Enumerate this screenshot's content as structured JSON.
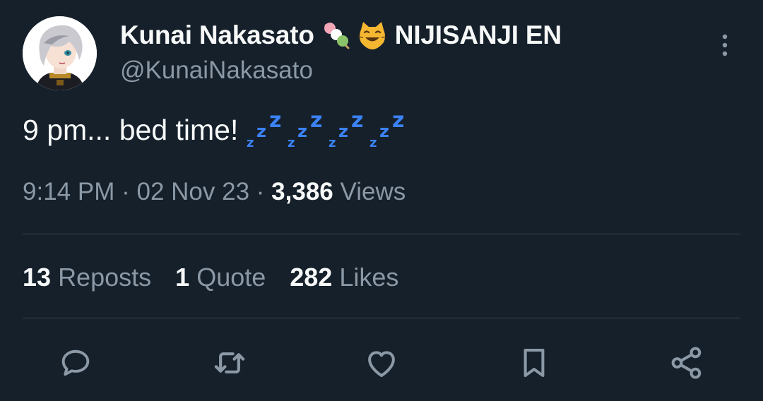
{
  "author": {
    "display_name": "Kunai Nakasato",
    "name_emojis": [
      "dango-emoji",
      "smiling-cat-emoji"
    ],
    "affiliation": "NIJISANJI EN",
    "handle": "@KunaiNakasato"
  },
  "tweet": {
    "text": "9 pm... bed time!",
    "trailing_emoji": [
      "zzz-emoji",
      "zzz-emoji",
      "zzz-emoji",
      "zzz-emoji"
    ]
  },
  "meta": {
    "time": "9:14 PM",
    "separator": "·",
    "date": "02 Nov 23",
    "views_count": "3,386",
    "views_label": "Views"
  },
  "stats": {
    "reposts_count": "13",
    "reposts_label": "Reposts",
    "quotes_count": "1",
    "quotes_label": "Quote",
    "likes_count": "282",
    "likes_label": "Likes"
  },
  "actions": [
    "reply-icon",
    "repost-icon",
    "like-icon",
    "bookmark-icon",
    "share-icon"
  ],
  "colors": {
    "background": "#15202b",
    "primary_text": "#f7f9f9",
    "secondary_text": "#8b98a5",
    "divider": "#38444d",
    "zzz_blue": "#3b82f6"
  }
}
